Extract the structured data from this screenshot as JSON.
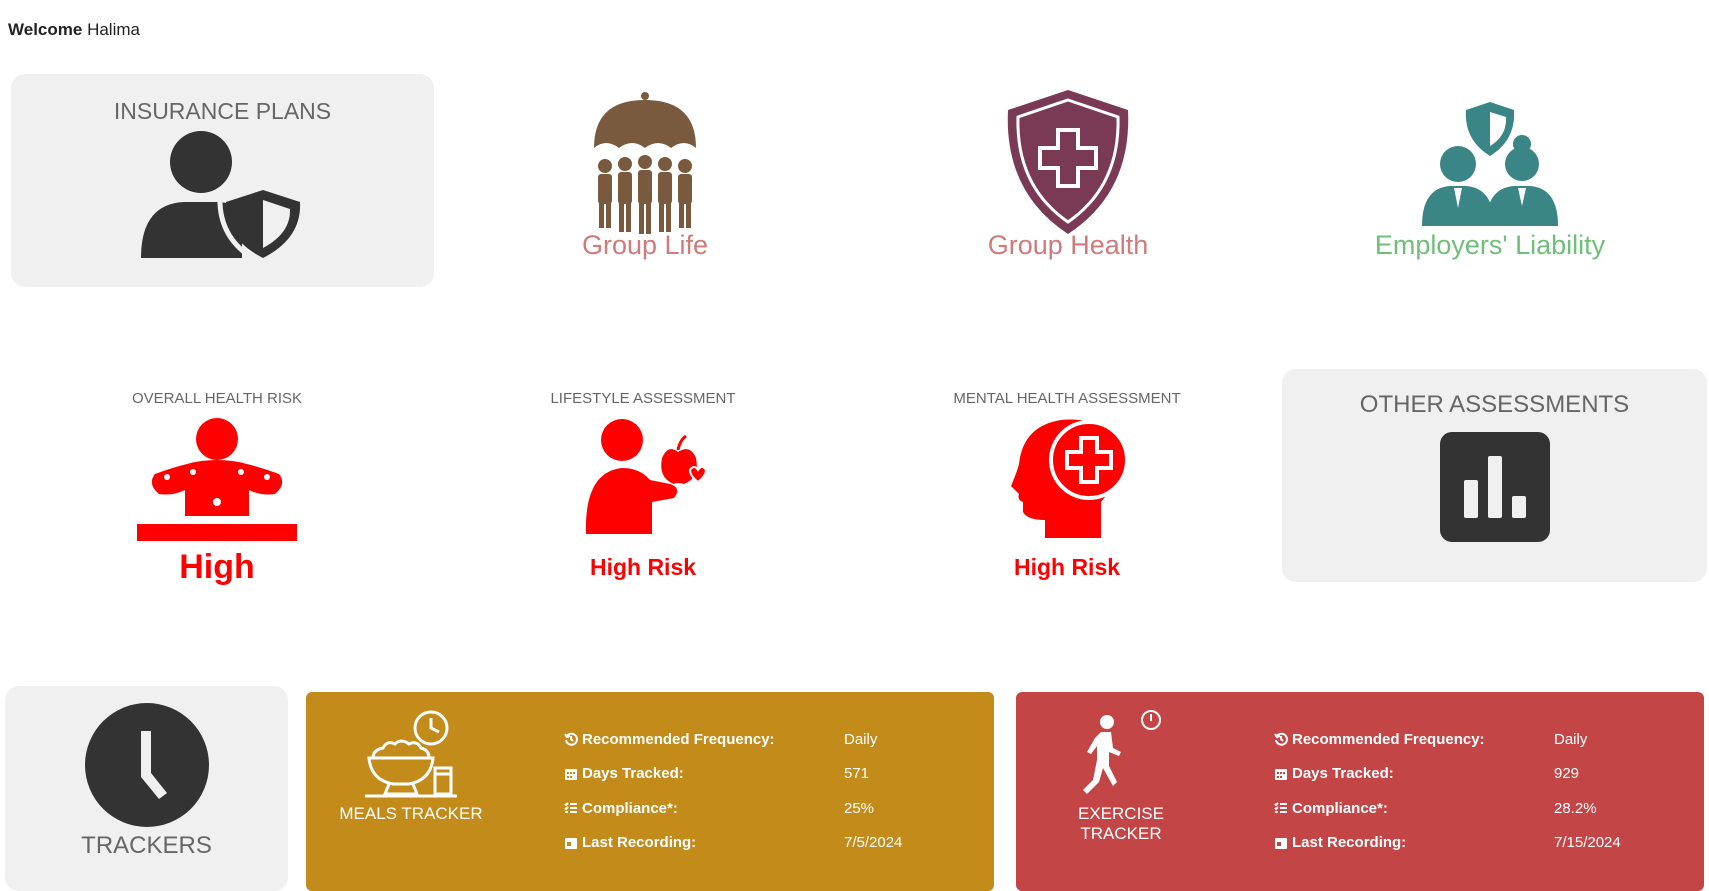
{
  "welcome": {
    "prefix": "Welcome",
    "name": "Halima"
  },
  "insurance": {
    "card_title": "INSURANCE PLANS",
    "card_icon": "user-shield-icon",
    "plans": [
      {
        "label": "Group Life",
        "icon": "umbrella-group-icon",
        "color": "#d27a7a"
      },
      {
        "label": "Group Health",
        "icon": "shield-cross-icon",
        "color": "#d27a7a"
      },
      {
        "label": "Employers' Liability",
        "icon": "people-shield-icon",
        "color": "#6fbf7a"
      }
    ]
  },
  "assessments": {
    "items": [
      {
        "title": "OVERALL HEALTH RISK",
        "value": "High",
        "icon": "health-risk-person-icon"
      },
      {
        "title": "LIFESTYLE ASSESSMENT",
        "value": "High Risk",
        "icon": "person-apple-icon"
      },
      {
        "title": "MENTAL HEALTH ASSESSMENT",
        "value": "High Risk",
        "icon": "head-cross-icon"
      }
    ],
    "other_title": "OTHER ASSESSMENTS",
    "other_icon": "bar-chart-icon",
    "risk_color": "#ff0000"
  },
  "trackers": {
    "card_title": "TRACKERS",
    "card_icon": "clock-icon",
    "labels": {
      "frequency": "Recommended Frequency:",
      "days": "Days Tracked:",
      "compliance": "Compliance*:",
      "last": "Last Recording:"
    },
    "meals": {
      "name": "MEALS TRACKER",
      "icon": "meal-bowl-clock-icon",
      "color": "#c28b1a",
      "frequency": "Daily",
      "days": "571",
      "compliance": "25%",
      "last": "7/5/2024"
    },
    "exercise": {
      "name": "EXERCISE TRACKER",
      "icon": "running-person-icon",
      "color": "#c44546",
      "frequency": "Daily",
      "days": "929",
      "compliance": "28.2%",
      "last": "7/15/2024"
    }
  }
}
